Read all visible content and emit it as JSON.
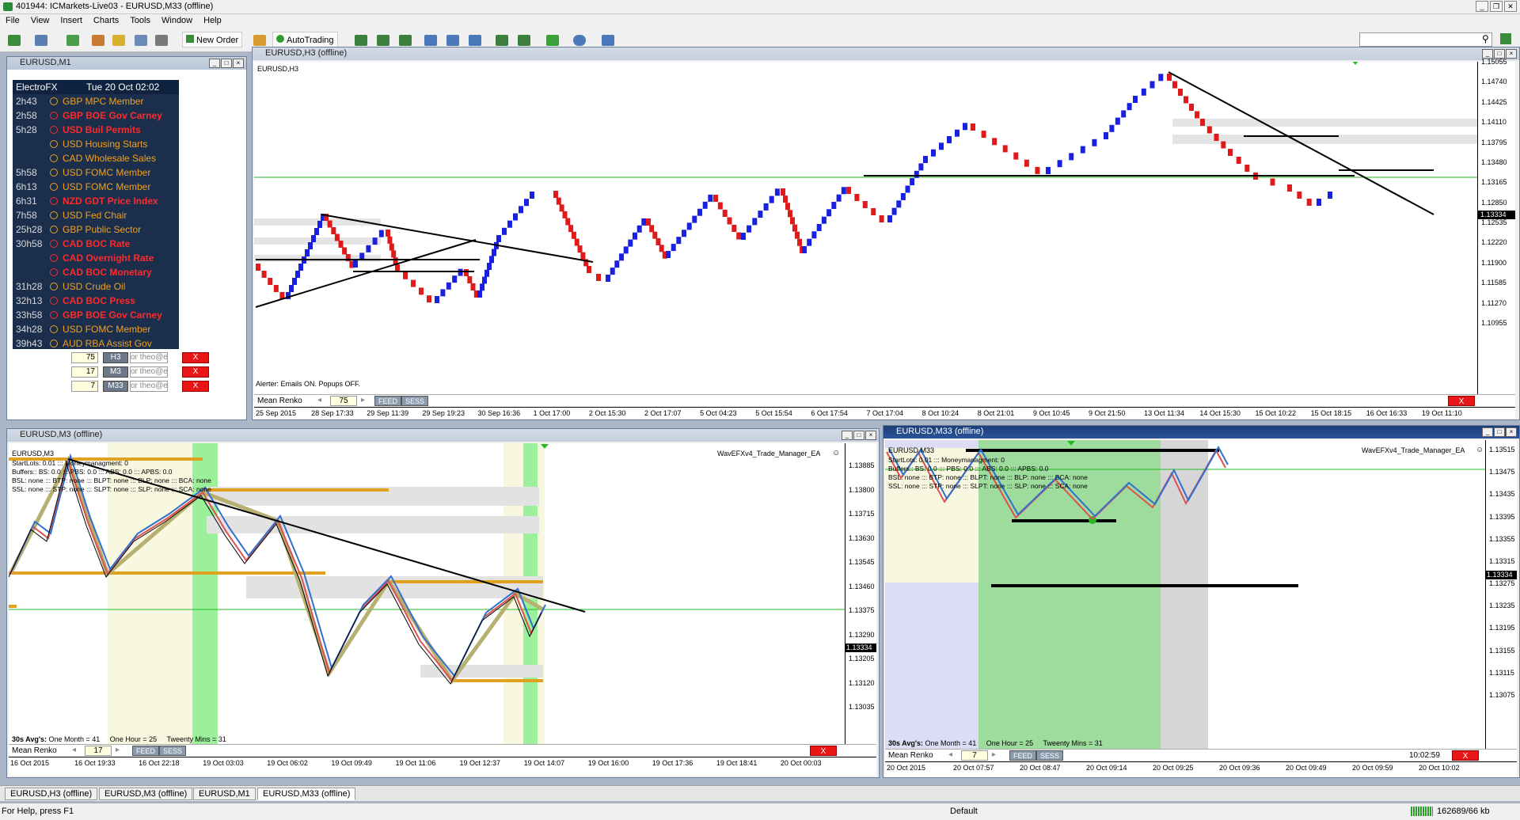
{
  "app": {
    "title": "401944: ICMarkets-Live03 - EURUSD,M33 (offline)"
  },
  "menu": [
    "File",
    "View",
    "Insert",
    "Charts",
    "Tools",
    "Window",
    "Help"
  ],
  "toolbar": {
    "new_order": "New Order",
    "autotrading": "AutoTrading"
  },
  "win_m1": {
    "title": "EURUSD,M1",
    "header_left": "ElectroFX",
    "header_right": "Tue 20 Oct 02:02",
    "news": [
      {
        "time": "2h43",
        "text": "GBP MPC Member",
        "color": "#f0a020",
        "bold": false
      },
      {
        "time": "2h58",
        "text": "GBP BOE Gov Carney",
        "color": "#ff2a2a",
        "bold": true
      },
      {
        "time": "5h28",
        "text": "USD Buil Permits",
        "color": "#ff2a2a",
        "bold": true
      },
      {
        "time": "",
        "text": "USD Housing Starts",
        "color": "#f0a020",
        "bold": false
      },
      {
        "time": "",
        "text": "CAD Wholesale Sales",
        "color": "#f0a020",
        "bold": false
      },
      {
        "time": "5h58",
        "text": "USD FOMC Member",
        "color": "#f0a020",
        "bold": false
      },
      {
        "time": "6h13",
        "text": "USD FOMC Member",
        "color": "#f0a020",
        "bold": false
      },
      {
        "time": "6h31",
        "text": "NZD GDT Price Index",
        "color": "#ff2a2a",
        "bold": true
      },
      {
        "time": "7h58",
        "text": "USD Fed Chair",
        "color": "#f0a020",
        "bold": false
      },
      {
        "time": "25h28",
        "text": "GBP Public Sector",
        "color": "#f0a020",
        "bold": false
      },
      {
        "time": "30h58",
        "text": "CAD BOC Rate",
        "color": "#ff2a2a",
        "bold": true
      },
      {
        "time": "",
        "text": "CAD Overnight Rate",
        "color": "#ff2a2a",
        "bold": true
      },
      {
        "time": "",
        "text": "CAD BOC Monetary",
        "color": "#ff2a2a",
        "bold": true
      },
      {
        "time": "31h28",
        "text": "USD Crude Oil",
        "color": "#f0a020",
        "bold": false
      },
      {
        "time": "32h13",
        "text": "CAD BOC Press",
        "color": "#ff2a2a",
        "bold": true
      },
      {
        "time": "33h58",
        "text": "GBP BOE Gov Carney",
        "color": "#ff2a2a",
        "bold": true
      },
      {
        "time": "34h28",
        "text": "USD FOMC Member",
        "color": "#f0a020",
        "bold": false
      },
      {
        "time": "39h43",
        "text": "AUD RBA Assist Gov",
        "color": "#f0a020",
        "bold": false
      }
    ],
    "alerts": [
      {
        "val": "75",
        "tf": "H3",
        "email": "or theo@e",
        "x": "X"
      },
      {
        "val": "17",
        "tf": "M3",
        "email": "or theo@e",
        "x": "X"
      },
      {
        "val": "7",
        "tf": "M33",
        "email": "or theo@e",
        "x": "X"
      }
    ]
  },
  "win_h3": {
    "title": "EURUSD,H3 (offline)",
    "label": "EURUSD,H3",
    "alert": "Alerter:  Emails ON.  Popups OFF.",
    "mean_renko": "Mean Renko",
    "renko_val": "75",
    "feed": "FEED",
    "sess": "SESS",
    "x": "X",
    "price_badge": "1.13334",
    "yticks": [
      "1.15055",
      "1.14740",
      "1.14425",
      "1.14110",
      "1.13795",
      "1.13480",
      "1.13165",
      "1.12850",
      "1.12535",
      "1.12220",
      "1.11900",
      "1.11585",
      "1.11270",
      "1.10955"
    ],
    "xticks": [
      "25 Sep 2015",
      "28 Sep 17:33",
      "29 Sep 11:39",
      "29 Sep 19:23",
      "30 Sep 16:36",
      "1 Oct 17:00",
      "2 Oct 15:30",
      "2 Oct 17:07",
      "5 Oct 04:23",
      "5 Oct 15:54",
      "6 Oct 17:54",
      "7 Oct 17:04",
      "8 Oct 10:24",
      "8 Oct 21:01",
      "9 Oct 10:45",
      "9 Oct 21:50",
      "13 Oct 11:34",
      "14 Oct 15:30",
      "15 Oct 10:22",
      "15 Oct 18:15",
      "16 Oct 16:33",
      "19 Oct 11:10"
    ]
  },
  "win_m3": {
    "title": "EURUSD,M3 (offline)",
    "label": "EURUSD,M3",
    "ea": "WavEFXv4_Trade_Manager_EA",
    "info": [
      "StartLots: 0.01 ::: Moneymanagment: 0",
      "Buffers:: BS: 0.0  ::: PBS: 0.0  ::: ABS: 0.0  ::: APBS: 0.0",
      "BSL: none ::: BTP: none ::: BLPT: none ::: BLP: none ::: BCA: none",
      "SSL: none ::: STP: none ::: SLPT: none ::: SLP: none ::: SCA: none"
    ],
    "avgs_label": "30s Avg's:",
    "avgs": "One Month = 41     One Hour = 25     Tweenty Mins = 31",
    "mean_renko": "Mean Renko",
    "renko_val": "17",
    "feed": "FEED",
    "sess": "SESS",
    "x": "X",
    "price_badge": "1.13334",
    "yticks": [
      "1.13885",
      "1.13800",
      "1.13715",
      "1.13630",
      "1.13545",
      "1.13460",
      "1.13375",
      "1.13290",
      "1.13205",
      "1.13120",
      "1.13035"
    ],
    "xticks": [
      "16 Oct 2015",
      "16 Oct 19:33",
      "16 Oct 22:18",
      "19 Oct 03:03",
      "19 Oct 06:02",
      "19 Oct 09:49",
      "19 Oct 11:06",
      "19 Oct 12:37",
      "19 Oct 14:07",
      "19 Oct 16:00",
      "19 Oct 17:36",
      "19 Oct 18:41",
      "20 Oct 00:03"
    ]
  },
  "win_m33": {
    "title": "EURUSD,M33 (offline)",
    "label": "EURUSD,M33",
    "ea": "WavEFXv4_Trade_Manager_EA",
    "info": [
      "StartLots: 0.01 ::: Moneymanagment: 0",
      "Buffers:: BS: 0.0  ::: PBS: 0.0  ::: ABS: 0.0  ::: APBS: 0.0",
      "BSL: none ::: BTP: none ::: BLPT: none ::: BLP: none ::: BCA: none",
      "SSL: none ::: STP: none ::: SLPT: none ::: SLP: none ::: SCA: none"
    ],
    "avgs_label": "30s Avg's:",
    "avgs": "One Month = 41     One Hour = 25     Tweenty Mins = 31",
    "mean_renko": "Mean Renko",
    "renko_val": "7",
    "feed": "FEED",
    "sess": "SESS",
    "x": "X",
    "clock": "10:02:59",
    "price_badge": "1.13334",
    "yticks": [
      "1.13515",
      "1.13475",
      "1.13435",
      "1.13395",
      "1.13355",
      "1.13315",
      "1.13275",
      "1.13235",
      "1.13195",
      "1.13155",
      "1.13115",
      "1.13075"
    ],
    "xticks": [
      "20 Oct 2015",
      "20 Oct 07:57",
      "20 Oct 08:47",
      "20 Oct 09:14",
      "20 Oct 09:25",
      "20 Oct 09:36",
      "20 Oct 09:49",
      "20 Oct 09:59",
      "20 Oct 10:02"
    ]
  },
  "tabs": [
    "EURUSD,H3 (offline)",
    "EURUSD,M3 (offline)",
    "EURUSD,M1",
    "EURUSD,M33 (offline)"
  ],
  "status": {
    "help": "For Help, press F1",
    "profile": "Default",
    "traffic": "162689/66 kb"
  }
}
